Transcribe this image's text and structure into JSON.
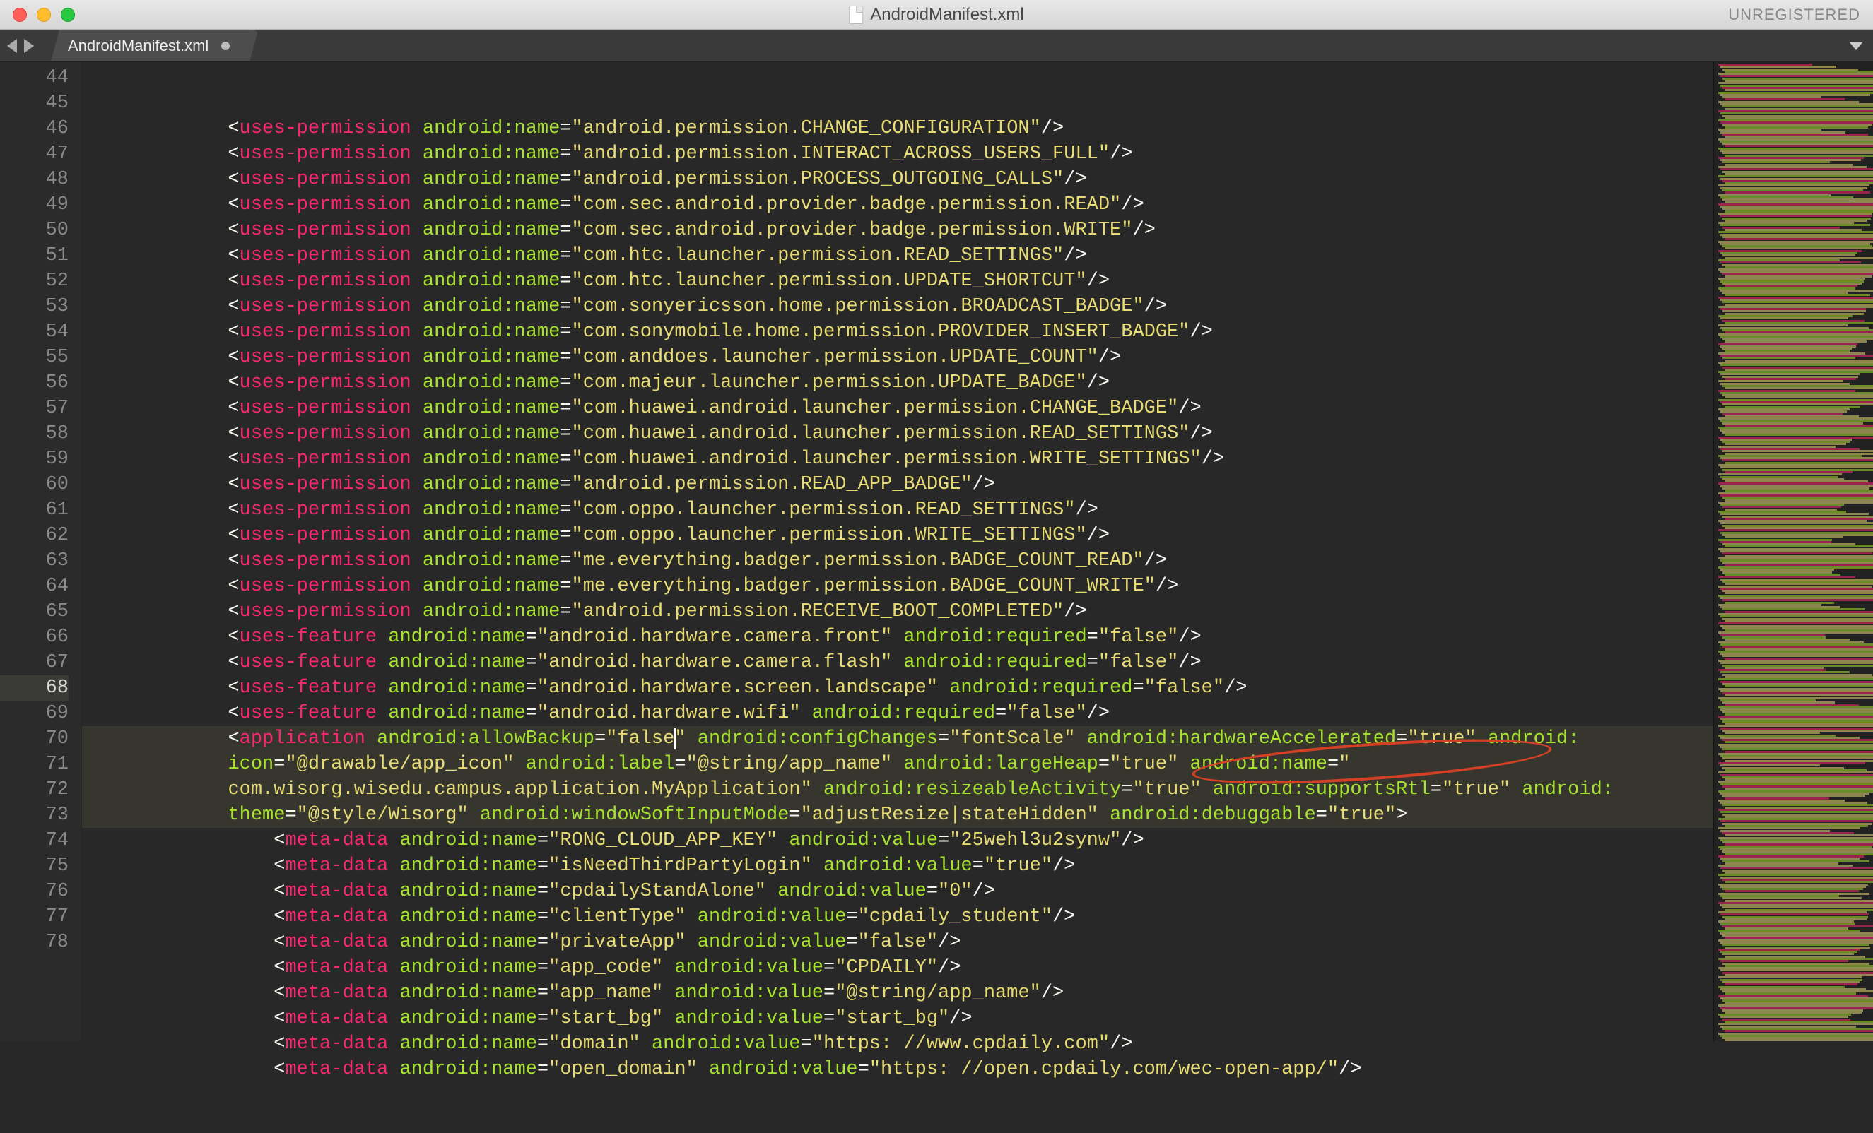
{
  "window": {
    "title": "AndroidManifest.xml",
    "unregistered": "UNREGISTERED"
  },
  "tab": {
    "label": "AndroidManifest.xml",
    "modified": true
  },
  "editor": {
    "active_line": 68,
    "lines": [
      {
        "n": 44,
        "type": "uses-permission",
        "indent": 3,
        "attrs": [
          [
            "android:name",
            "android.permission.CHANGE_CONFIGURATION"
          ]
        ],
        "cutoff_top": true
      },
      {
        "n": 45,
        "type": "uses-permission",
        "indent": 3,
        "attrs": [
          [
            "android:name",
            "android.permission.INTERACT_ACROSS_USERS_FULL"
          ]
        ]
      },
      {
        "n": 46,
        "type": "uses-permission",
        "indent": 3,
        "attrs": [
          [
            "android:name",
            "android.permission.PROCESS_OUTGOING_CALLS"
          ]
        ]
      },
      {
        "n": 47,
        "type": "uses-permission",
        "indent": 3,
        "attrs": [
          [
            "android:name",
            "com.sec.android.provider.badge.permission.READ"
          ]
        ]
      },
      {
        "n": 48,
        "type": "uses-permission",
        "indent": 3,
        "attrs": [
          [
            "android:name",
            "com.sec.android.provider.badge.permission.WRITE"
          ]
        ]
      },
      {
        "n": 49,
        "type": "uses-permission",
        "indent": 3,
        "attrs": [
          [
            "android:name",
            "com.htc.launcher.permission.READ_SETTINGS"
          ]
        ]
      },
      {
        "n": 50,
        "type": "uses-permission",
        "indent": 3,
        "attrs": [
          [
            "android:name",
            "com.htc.launcher.permission.UPDATE_SHORTCUT"
          ]
        ]
      },
      {
        "n": 51,
        "type": "uses-permission",
        "indent": 3,
        "attrs": [
          [
            "android:name",
            "com.sonyericsson.home.permission.BROADCAST_BADGE"
          ]
        ]
      },
      {
        "n": 52,
        "type": "uses-permission",
        "indent": 3,
        "attrs": [
          [
            "android:name",
            "com.sonymobile.home.permission.PROVIDER_INSERT_BADGE"
          ]
        ]
      },
      {
        "n": 53,
        "type": "uses-permission",
        "indent": 3,
        "attrs": [
          [
            "android:name",
            "com.anddoes.launcher.permission.UPDATE_COUNT"
          ]
        ]
      },
      {
        "n": 54,
        "type": "uses-permission",
        "indent": 3,
        "attrs": [
          [
            "android:name",
            "com.majeur.launcher.permission.UPDATE_BADGE"
          ]
        ]
      },
      {
        "n": 55,
        "type": "uses-permission",
        "indent": 3,
        "attrs": [
          [
            "android:name",
            "com.huawei.android.launcher.permission.CHANGE_BADGE"
          ]
        ]
      },
      {
        "n": 56,
        "type": "uses-permission",
        "indent": 3,
        "attrs": [
          [
            "android:name",
            "com.huawei.android.launcher.permission.READ_SETTINGS"
          ]
        ]
      },
      {
        "n": 57,
        "type": "uses-permission",
        "indent": 3,
        "attrs": [
          [
            "android:name",
            "com.huawei.android.launcher.permission.WRITE_SETTINGS"
          ]
        ]
      },
      {
        "n": 58,
        "type": "uses-permission",
        "indent": 3,
        "attrs": [
          [
            "android:name",
            "android.permission.READ_APP_BADGE"
          ]
        ]
      },
      {
        "n": 59,
        "type": "uses-permission",
        "indent": 3,
        "attrs": [
          [
            "android:name",
            "com.oppo.launcher.permission.READ_SETTINGS"
          ]
        ]
      },
      {
        "n": 60,
        "type": "uses-permission",
        "indent": 3,
        "attrs": [
          [
            "android:name",
            "com.oppo.launcher.permission.WRITE_SETTINGS"
          ]
        ]
      },
      {
        "n": 61,
        "type": "uses-permission",
        "indent": 3,
        "attrs": [
          [
            "android:name",
            "me.everything.badger.permission.BADGE_COUNT_READ"
          ]
        ]
      },
      {
        "n": 62,
        "type": "uses-permission",
        "indent": 3,
        "attrs": [
          [
            "android:name",
            "me.everything.badger.permission.BADGE_COUNT_WRITE"
          ]
        ]
      },
      {
        "n": 63,
        "type": "uses-permission",
        "indent": 3,
        "attrs": [
          [
            "android:name",
            "android.permission.RECEIVE_BOOT_COMPLETED"
          ]
        ]
      },
      {
        "n": 64,
        "type": "uses-feature",
        "indent": 3,
        "attrs": [
          [
            "android:name",
            "android.hardware.camera.front"
          ],
          [
            "android:required",
            "false"
          ]
        ]
      },
      {
        "n": 65,
        "type": "uses-feature",
        "indent": 3,
        "attrs": [
          [
            "android:name",
            "android.hardware.camera.flash"
          ],
          [
            "android:required",
            "false"
          ]
        ]
      },
      {
        "n": 66,
        "type": "uses-feature",
        "indent": 3,
        "attrs": [
          [
            "android:name",
            "android.hardware.screen.landscape"
          ],
          [
            "android:required",
            "false"
          ]
        ]
      },
      {
        "n": 67,
        "type": "uses-feature",
        "indent": 3,
        "attrs": [
          [
            "android:name",
            "android.hardware.wifi"
          ],
          [
            "android:required",
            "false"
          ]
        ]
      },
      {
        "n": 68,
        "type": "application-open",
        "indent": 3
      },
      {
        "n": 69,
        "type": "meta-data",
        "indent": 4,
        "attrs": [
          [
            "android:name",
            "RONG_CLOUD_APP_KEY"
          ],
          [
            "android:value",
            "25wehl3u2synw"
          ]
        ]
      },
      {
        "n": 70,
        "type": "meta-data",
        "indent": 4,
        "attrs": [
          [
            "android:name",
            "isNeedThirdPartyLogin"
          ],
          [
            "android:value",
            "true"
          ]
        ]
      },
      {
        "n": 71,
        "type": "meta-data",
        "indent": 4,
        "attrs": [
          [
            "android:name",
            "cpdailyStandAlone"
          ],
          [
            "android:value",
            "0"
          ]
        ]
      },
      {
        "n": 72,
        "type": "meta-data",
        "indent": 4,
        "attrs": [
          [
            "android:name",
            "clientType"
          ],
          [
            "android:value",
            "cpdaily_student"
          ]
        ]
      },
      {
        "n": 73,
        "type": "meta-data",
        "indent": 4,
        "attrs": [
          [
            "android:name",
            "privateApp"
          ],
          [
            "android:value",
            "false"
          ]
        ]
      },
      {
        "n": 74,
        "type": "meta-data",
        "indent": 4,
        "attrs": [
          [
            "android:name",
            "app_code"
          ],
          [
            "android:value",
            "CPDAILY"
          ]
        ]
      },
      {
        "n": 75,
        "type": "meta-data",
        "indent": 4,
        "attrs": [
          [
            "android:name",
            "app_name"
          ],
          [
            "android:value",
            "@string/app_name"
          ]
        ]
      },
      {
        "n": 76,
        "type": "meta-data",
        "indent": 4,
        "attrs": [
          [
            "android:name",
            "start_bg"
          ],
          [
            "android:value",
            "start_bg"
          ]
        ]
      },
      {
        "n": 77,
        "type": "meta-data",
        "indent": 4,
        "attrs": [
          [
            "android:name",
            "domain"
          ],
          [
            "android:value",
            "https: //www.cpdaily.com"
          ]
        ]
      },
      {
        "n": 78,
        "type": "meta-data",
        "indent": 4,
        "attrs": [
          [
            "android:name",
            "open_domain"
          ],
          [
            "android:value",
            "https: //open.cpdaily.com/wec-open-app/"
          ]
        ]
      }
    ],
    "application": {
      "segments": [
        {
          "text": "<",
          "cls": "wht"
        },
        {
          "text": "application",
          "cls": "pnk"
        },
        {
          "text": " ",
          "cls": "wht"
        },
        {
          "text": "android:allowBackup",
          "cls": "grn"
        },
        {
          "text": "=",
          "cls": "wht"
        },
        {
          "text": "\"false",
          "cls": "ylw"
        },
        {
          "text": "CARET",
          "cls": "caret"
        },
        {
          "text": "\"",
          "cls": "ylw"
        },
        {
          "text": " ",
          "cls": "wht"
        },
        {
          "text": "android:configChanges",
          "cls": "grn"
        },
        {
          "text": "=",
          "cls": "wht"
        },
        {
          "text": "\"fontScale\"",
          "cls": "ylw"
        },
        {
          "text": " ",
          "cls": "wht"
        },
        {
          "text": "android:hardwareAccelerated",
          "cls": "grn"
        },
        {
          "text": "=",
          "cls": "wht"
        },
        {
          "text": "\"true\"",
          "cls": "ylw"
        },
        {
          "text": " ",
          "cls": "wht"
        },
        {
          "text": "android:",
          "cls": "grn"
        },
        {
          "text": "NEWLINE"
        },
        {
          "text": "icon",
          "cls": "grn"
        },
        {
          "text": "=",
          "cls": "wht"
        },
        {
          "text": "\"@drawable/app_icon\"",
          "cls": "ylw"
        },
        {
          "text": " ",
          "cls": "wht"
        },
        {
          "text": "android:label",
          "cls": "grn"
        },
        {
          "text": "=",
          "cls": "wht"
        },
        {
          "text": "\"@string/app_name\"",
          "cls": "ylw"
        },
        {
          "text": " ",
          "cls": "wht"
        },
        {
          "text": "android:largeHeap",
          "cls": "grn"
        },
        {
          "text": "=",
          "cls": "wht"
        },
        {
          "text": "\"true\"",
          "cls": "ylw"
        },
        {
          "text": " ",
          "cls": "wht"
        },
        {
          "text": "android:name",
          "cls": "grn"
        },
        {
          "text": "=",
          "cls": "wht"
        },
        {
          "text": "\"",
          "cls": "ylw"
        },
        {
          "text": "NEWLINE"
        },
        {
          "text": "com.wisorg.wisedu.campus.application.MyApplication\"",
          "cls": "ylw"
        },
        {
          "text": " ",
          "cls": "wht"
        },
        {
          "text": "android:resizeableActivity",
          "cls": "grn"
        },
        {
          "text": "=",
          "cls": "wht"
        },
        {
          "text": "\"true\"",
          "cls": "ylw"
        },
        {
          "text": " ",
          "cls": "wht"
        },
        {
          "text": "android:supportsRtl",
          "cls": "grn"
        },
        {
          "text": "=",
          "cls": "wht"
        },
        {
          "text": "\"true\"",
          "cls": "ylw"
        },
        {
          "text": " ",
          "cls": "wht"
        },
        {
          "text": "android:",
          "cls": "grn"
        },
        {
          "text": "NEWLINE"
        },
        {
          "text": "theme",
          "cls": "grn"
        },
        {
          "text": "=",
          "cls": "wht"
        },
        {
          "text": "\"@style/Wisorg\"",
          "cls": "ylw"
        },
        {
          "text": " ",
          "cls": "wht"
        },
        {
          "text": "android:windowSoftInputMode",
          "cls": "grn"
        },
        {
          "text": "=",
          "cls": "wht"
        },
        {
          "text": "\"adjustResize|stateHidden\"",
          "cls": "ylw"
        },
        {
          "text": " ",
          "cls": "wht"
        },
        {
          "text": "android:debuggable",
          "cls": "grn"
        },
        {
          "text": "=",
          "cls": "wht"
        },
        {
          "text": "\"true\"",
          "cls": "ylw"
        },
        {
          "text": ">",
          "cls": "wht"
        }
      ]
    }
  },
  "annotation": {
    "circled_attribute": "android:debuggable=\"true\""
  }
}
